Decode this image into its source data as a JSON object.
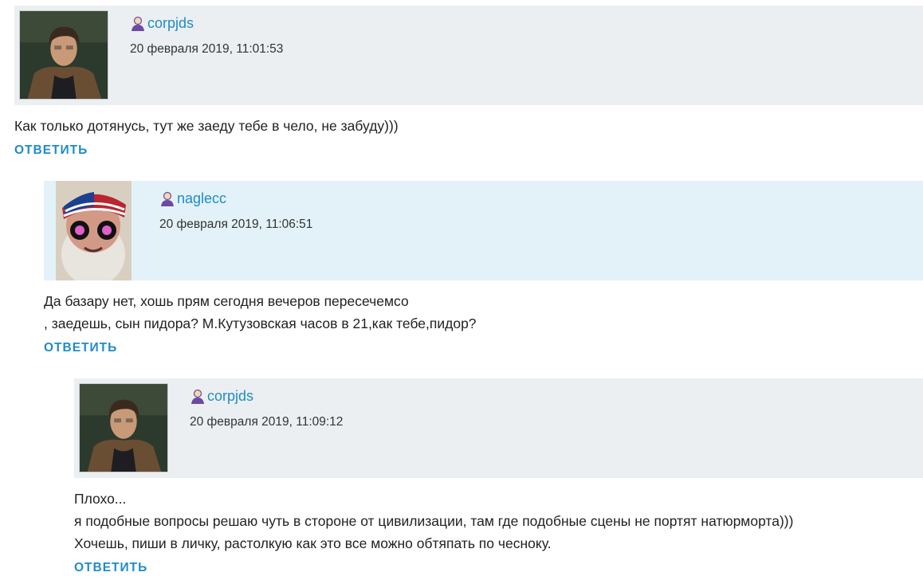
{
  "comments": [
    {
      "username": "corpjds",
      "date": "20 февраля 2019, 11:01:53",
      "avatar": "man-photo-avatar",
      "lines": [
        "Как только дотянусь, тут же заеду тебе в чело, не забуду)))"
      ],
      "reply_label": "ОТВЕТИТЬ"
    },
    {
      "username": "naglecc",
      "date": "20 февраля 2019, 11:06:51",
      "avatar": "bearded-man-bandana-avatar",
      "lines": [
        "Да базару нет, хошь прям сегодня вечеров пересечемсо",
        ", заедешь, сын пидора? М.Кутузовская часов в 21,как тебе,пидор?"
      ],
      "reply_label": "ОТВЕТИТЬ"
    },
    {
      "username": "corpjds",
      "date": "20 февраля 2019, 11:09:12",
      "avatar": "man-photo-avatar",
      "lines": [
        "Плохо...",
        "я подобные вопросы решаю чуть в стороне от цивилизации, там где подобные сцены не портят натюрморта)))",
        "Хочешь, пиши в личку, растолкую как это все можно обтяпать по чесноку."
      ],
      "reply_label": "ОТВЕТИТЬ"
    }
  ],
  "colors": {
    "link": "#1f8cc8",
    "header_gray": "#eceff2",
    "header_light_blue": "#e3f2f8"
  }
}
